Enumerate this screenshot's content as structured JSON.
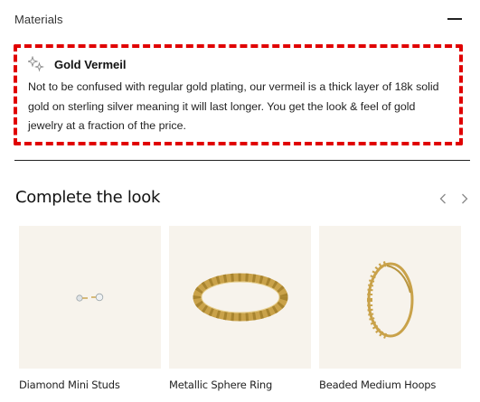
{
  "materials": {
    "header_label": "Materials",
    "collapse_icon": "minus-icon",
    "item": {
      "icon": "sparkle-icon",
      "title": "Gold Vermeil",
      "description": "Not to be confused with regular gold plating, our vermeil is a thick layer of 18k solid gold on sterling silver meaning it will last longer. You get the look & feel of gold jewelry at a fraction of the price."
    }
  },
  "complete_the_look": {
    "title": "Complete the look",
    "prev_icon": "chevron-left-icon",
    "next_icon": "chevron-right-icon",
    "products": [
      {
        "name": "Diamond Mini Studs",
        "image": "diamond-studs-image"
      },
      {
        "name": "Metallic Sphere Ring",
        "image": "sphere-ring-image"
      },
      {
        "name": "Beaded Medium Hoops",
        "image": "beaded-hoops-image"
      }
    ]
  },
  "colors": {
    "highlight_border": "#e00000",
    "product_bg": "#f7f3ec",
    "gold": "#c9a24a"
  }
}
